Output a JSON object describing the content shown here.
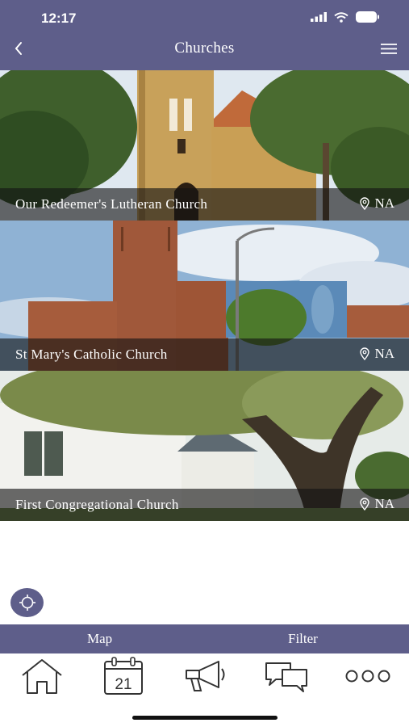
{
  "status_bar": {
    "time": "12:17"
  },
  "header": {
    "title": "Churches"
  },
  "churches": [
    {
      "name": "Our Redeemer's Lutheran Church",
      "location": "NA"
    },
    {
      "name": "St Mary's Catholic Church",
      "location": "NA"
    },
    {
      "name": "First Congregational Church",
      "location": "NA"
    }
  ],
  "actions": {
    "map_label": "Map",
    "filter_label": "Filter"
  },
  "tabbar": {
    "calendar_day": "21"
  },
  "colors": {
    "brand": "#5e5e8a",
    "overlay": "rgba(20,20,20,0.62)"
  },
  "icons": [
    "back-icon",
    "menu-icon",
    "location-pin-icon",
    "locate-icon",
    "home-icon",
    "calendar-icon",
    "megaphone-icon",
    "chat-icon",
    "more-icon"
  ]
}
